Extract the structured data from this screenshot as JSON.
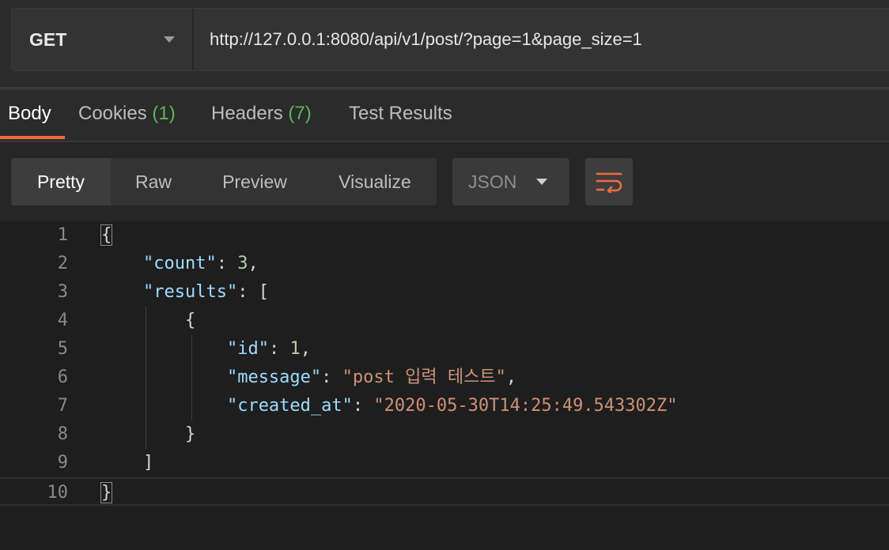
{
  "request": {
    "method": "GET",
    "url": "http://127.0.0.1:8080/api/v1/post/?page=1&page_size=1"
  },
  "response_tabs": [
    {
      "label": "Body",
      "count": ""
    },
    {
      "label": "Cookies",
      "count": "(1)"
    },
    {
      "label": "Headers",
      "count": "(7)"
    },
    {
      "label": "Test Results",
      "count": ""
    }
  ],
  "view_modes": [
    "Pretty",
    "Raw",
    "Preview",
    "Visualize"
  ],
  "format": {
    "selected": "JSON"
  },
  "icons": {
    "wrap": "wrap-lines-icon",
    "dropdown": "chevron-down-icon"
  },
  "colors": {
    "accent": "#f26b3a",
    "count": "#5fb25f",
    "key": "#9cdcfe",
    "string": "#ce9178",
    "number": "#b5cea8"
  },
  "editor": {
    "line_numbers": [
      "1",
      "2",
      "3",
      "4",
      "5",
      "6",
      "7",
      "8",
      "9",
      "10"
    ],
    "lines": [
      {
        "indent": "",
        "parts": [
          {
            "t": "{",
            "c": "p"
          }
        ]
      },
      {
        "indent": "    ",
        "parts": [
          {
            "t": "\"count\"",
            "c": "k"
          },
          {
            "t": ": ",
            "c": "p"
          },
          {
            "t": "3",
            "c": "n"
          },
          {
            "t": ",",
            "c": "p"
          }
        ]
      },
      {
        "indent": "    ",
        "parts": [
          {
            "t": "\"results\"",
            "c": "k"
          },
          {
            "t": ": [",
            "c": "p"
          }
        ]
      },
      {
        "indent": "        ",
        "parts": [
          {
            "t": "{",
            "c": "p"
          }
        ]
      },
      {
        "indent": "            ",
        "parts": [
          {
            "t": "\"id\"",
            "c": "k"
          },
          {
            "t": ": ",
            "c": "p"
          },
          {
            "t": "1",
            "c": "n"
          },
          {
            "t": ",",
            "c": "p"
          }
        ]
      },
      {
        "indent": "            ",
        "parts": [
          {
            "t": "\"message\"",
            "c": "k"
          },
          {
            "t": ": ",
            "c": "p"
          },
          {
            "t": "\"post 입력 테스트\"",
            "c": "s"
          },
          {
            "t": ",",
            "c": "p"
          }
        ]
      },
      {
        "indent": "            ",
        "parts": [
          {
            "t": "\"created_at\"",
            "c": "k"
          },
          {
            "t": ": ",
            "c": "p"
          },
          {
            "t": "\"2020-05-30T14:25:49.543302Z\"",
            "c": "s"
          }
        ]
      },
      {
        "indent": "        ",
        "parts": [
          {
            "t": "}",
            "c": "p"
          }
        ]
      },
      {
        "indent": "    ",
        "parts": [
          {
            "t": "]",
            "c": "p"
          }
        ]
      },
      {
        "indent": "",
        "parts": [
          {
            "t": "}",
            "c": "p"
          }
        ]
      }
    ]
  }
}
